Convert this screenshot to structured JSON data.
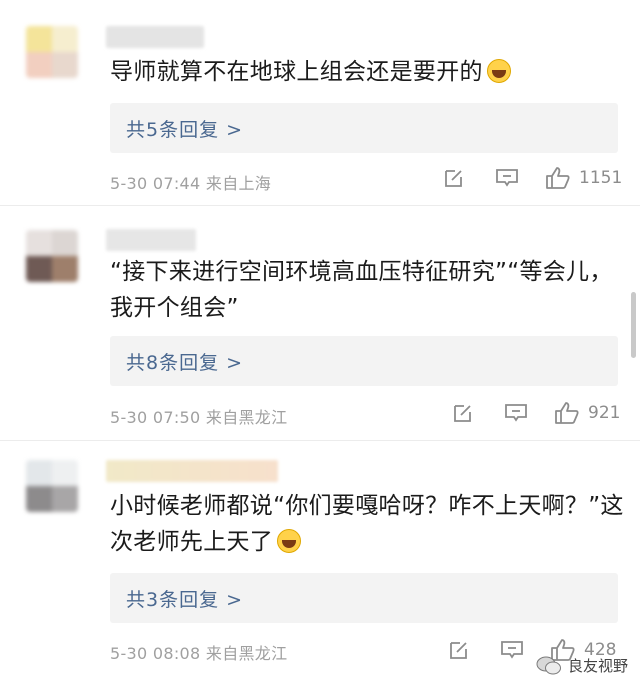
{
  "comments": [
    {
      "text": "导师就算不在地球上组会还是要开的",
      "reply_summary": "共5条回复 >",
      "meta": "5-30 07:44  来自上海",
      "likes": "1151"
    },
    {
      "text": "“接下来进行空间环境高血压特征研究”“等会儿，我开个组会”",
      "reply_summary": "共8条回复 >",
      "meta": "5-30 07:50  来自黑龙江",
      "likes": "921"
    },
    {
      "text": "小时候老师都说“你们要嘎哈呀？咋不上天啊？”这次老师先上天了",
      "reply_summary": "共3条回复 >",
      "meta": "5-30 08:08  来自黑龙江",
      "likes": "428"
    }
  ],
  "watermark": "良友视野",
  "icons": [
    "edit-icon",
    "comment-icon",
    "thumbs-up-icon",
    "laughing-emoji-icon",
    "crying-laughing-emoji-icon"
  ],
  "colors": {
    "reply_link": "#4a6890",
    "meta": "#a0a0a0",
    "reply_bg": "#f3f3f3"
  }
}
